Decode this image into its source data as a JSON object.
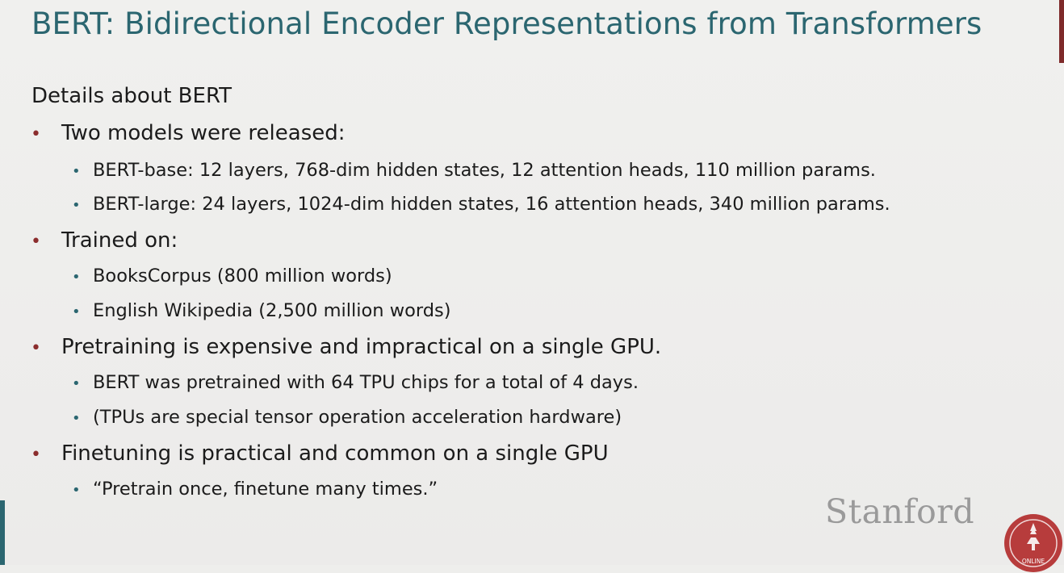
{
  "slide": {
    "title": "BERT: Bidirectional Encoder Representations from Transformers",
    "intro": "Details about BERT",
    "bullets": [
      {
        "text": "Two models were released:",
        "subs": [
          "BERT-base: 12 layers, 768-dim hidden states, 12 attention heads, 110 million params.",
          "BERT-large: 24 layers, 1024-dim hidden states, 16 attention heads, 340 million params."
        ]
      },
      {
        "text": "Trained on:",
        "subs": [
          "BooksCorpus (800 million words)",
          "English Wikipedia (2,500 million words)"
        ]
      },
      {
        "text": "Pretraining is expensive and impractical on a single GPU.",
        "subs": [
          "BERT was pretrained with 64 TPU chips for a total of 4 days.",
          "(TPUs are special tensor operation acceleration hardware)"
        ]
      },
      {
        "text": "Finetuning is practical and common on a single GPU",
        "subs": [
          "“Pretrain once, finetune many times.”"
        ]
      }
    ]
  },
  "branding": {
    "wordmark": "Stanford",
    "seal_label": "ONLINE",
    "title_color": "#2b6670",
    "accent_color": "#8b2d2d"
  }
}
